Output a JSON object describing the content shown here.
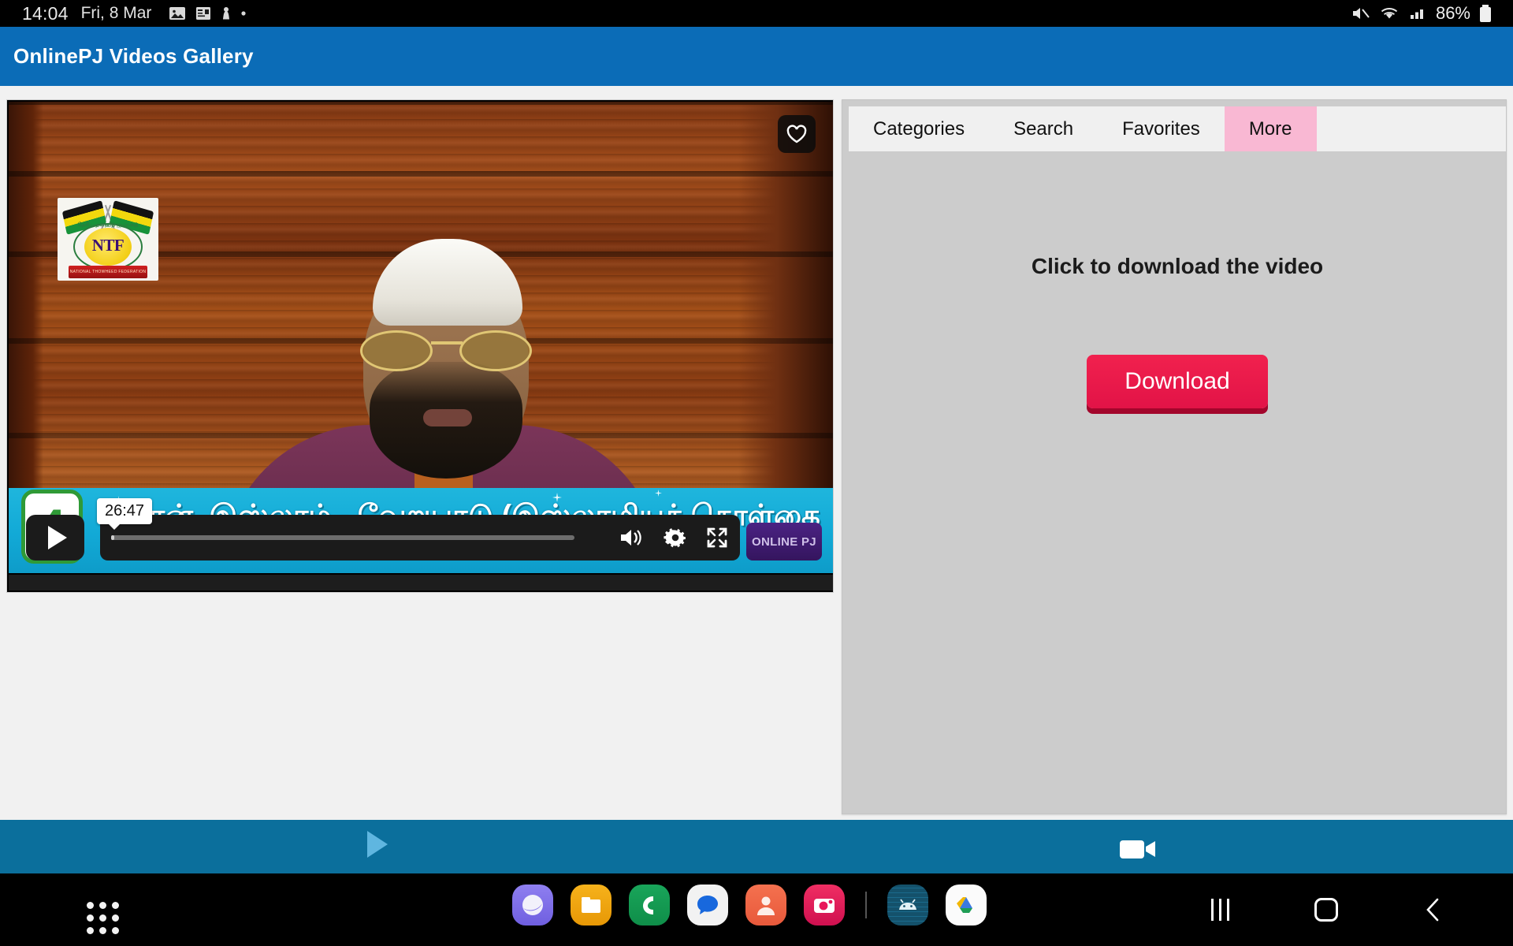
{
  "status_bar": {
    "time": "14:04",
    "date": "Fri, 8 Mar",
    "battery_percent": "86%",
    "left_icons": [
      "image-icon",
      "calendar-icon",
      "chess-pawn-icon",
      "dot-icon"
    ],
    "right_icons": [
      "mute-icon",
      "wifi-icon",
      "signal-icon",
      "battery-icon"
    ]
  },
  "app_bar": {
    "title": "OnlinePJ Videos Gallery",
    "color": "#0b6cb7"
  },
  "video": {
    "logo_text": "NTF",
    "logo_subtitle": "NATIONAL THOWHEED FEDERATION",
    "logo_tamil": "தேசிய தவ்ஹீத் ஜமாஅத்",
    "banner_text": "…மான், இஸ்லாம் - வேறுபாடு (இஸ்லாமியக் கொள்கை",
    "episode_number": "4",
    "timestamp_tooltip": "26:47",
    "watermark": "ONLINE PJ",
    "controls": [
      "play-button",
      "seek-bar",
      "volume-icon",
      "settings-gear-icon",
      "fullscreen-icon"
    ],
    "favorite_icon": "heart-outline-icon"
  },
  "right_panel": {
    "tabs": [
      {
        "label": "Categories",
        "active": false
      },
      {
        "label": "Search",
        "active": false
      },
      {
        "label": "Favorites",
        "active": false
      },
      {
        "label": "More",
        "active": true
      }
    ],
    "active_tab_color": "#f9b8d3",
    "download_title": "Click to download the video",
    "download_button": "Download",
    "download_button_color": "#e21347"
  },
  "bottom_bar": {
    "color": "#0b6f9c",
    "play_icon": "play-triangle-icon",
    "video_icon": "video-camera-icon"
  },
  "android_nav": {
    "app_drawer": "app-drawer-icon",
    "dock_apps": [
      "samsung-internet-icon",
      "my-files-icon",
      "phone-icon",
      "messages-icon",
      "contacts-icon",
      "camera-icon",
      "android-studio-icon",
      "google-drive-icon"
    ],
    "recents": "recents-icon",
    "home": "home-icon",
    "back": "back-icon"
  }
}
